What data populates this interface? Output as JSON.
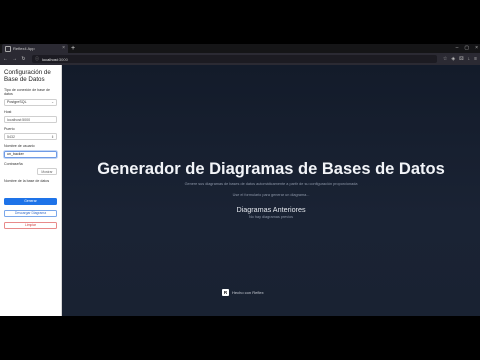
{
  "browser": {
    "tab_title": "Reflex4 App",
    "url_host": "localhost",
    "url_port": ":3000",
    "newtab_glyph": "+",
    "nav": {
      "back": "←",
      "forward": "→",
      "reload": "↻"
    }
  },
  "sidebar": {
    "title": "Configuración de Base de Datos",
    "db_type_label": "Tipo de conexión de base de datos",
    "db_type_value": "PostgreSQL",
    "host_label": "Host",
    "host_value": "localhost:5000",
    "port_label": "Puerto",
    "port_value": "5432",
    "user_label": "Nombre de usuario",
    "user_value": "un_backer",
    "password_label": "Contraseña",
    "password_toggle": "Mostrar",
    "dbname_label": "Nombre de la base de datos",
    "generate_button": "Generar",
    "download_button": "Descargar Diagrama",
    "clear_button": "Limpiar"
  },
  "main": {
    "title": "Generador de Diagramas de Bases de Datos",
    "subtitle": "Genere sus diagramas de bases de datos automáticamente a partir de su configuración proporcionada",
    "hint": "Use el formulario para generar un diagrama...",
    "previous_title": "Diagramas Anteriores",
    "previous_empty": "No hay diagramas previos",
    "credit_text": "Hecho con Reflex",
    "credit_logo": "R"
  }
}
